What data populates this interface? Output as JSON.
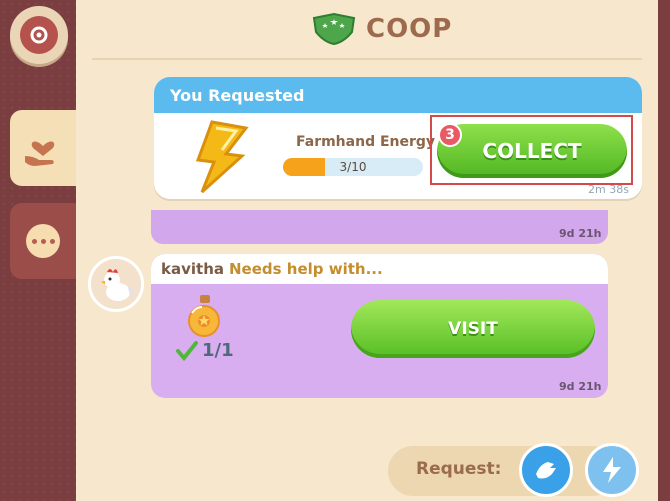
{
  "title": "COOP",
  "colors": {
    "accent_blue": "#5bbbee",
    "green": "#56bd24",
    "purple": "#d9aef0",
    "panel": "#f6e7cd",
    "rail": "#7a3e40"
  },
  "sidebar": {
    "items": [
      {
        "icon": "shield-gear-icon"
      },
      {
        "icon": "heart-hand-icon"
      },
      {
        "icon": "chat-bubble-icon"
      }
    ]
  },
  "requested": {
    "header": "You Requested",
    "item_name": "Farmhand Energy",
    "progress_text": "3/10",
    "progress_fraction": 0.3,
    "collect_label": "COLLECT",
    "badge_count": "3",
    "time": "2m 38s"
  },
  "previous_card": {
    "time": "9d 21h"
  },
  "help_card": {
    "user": "kavitha",
    "message": "Needs help with...",
    "progress": "1/1",
    "visit_label": "VISIT",
    "time": "9d 21h"
  },
  "request_bar": {
    "label": "Request:"
  }
}
